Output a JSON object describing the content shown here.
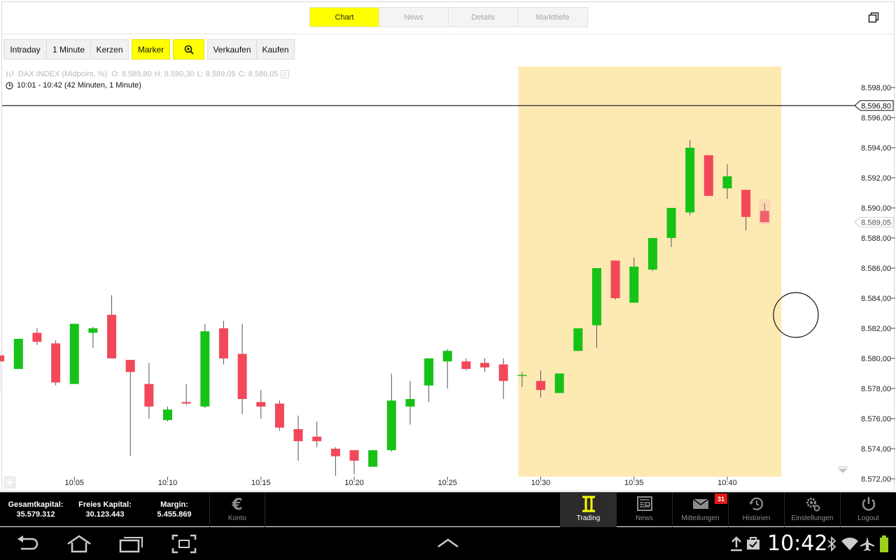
{
  "tabs": [
    {
      "label": "Chart",
      "active": true
    },
    {
      "label": "News",
      "active": false
    },
    {
      "label": "Details",
      "active": false
    },
    {
      "label": "Markttiefe",
      "active": false
    }
  ],
  "toolbar": {
    "intraday": "Intraday",
    "interval": "1 Minute",
    "kerzen": "Kerzen",
    "marker": "Marker",
    "zoom_icon": "zoom-in-icon",
    "verkaufen": "Verkaufen",
    "kaufen": "Kaufen"
  },
  "chart_info": {
    "instrument": "DAX INDEX (Midpoint, %)",
    "open": "O: 8.589,80",
    "high": "H: 8.590,30",
    "low": "L: 8.589,05",
    "close": "C: 8.589,05",
    "range": "10:01 - 10:42 (42 Minuten, 1 Minute)"
  },
  "chart_data": {
    "type": "candlestick",
    "y_ticks": [
      "8.572,00",
      "8.574,00",
      "8.576,00",
      "8.578,00",
      "8.580,00",
      "8.582,00",
      "8.584,00",
      "8.586,00",
      "8.588,00",
      "8.590,00",
      "8.592,00",
      "8.594,00",
      "8.596,00",
      "8.598,00"
    ],
    "ylim": [
      8571.9,
      8599.2
    ],
    "x_ticks": [
      "10:05",
      "10:10",
      "10:15",
      "10:20",
      "10:25",
      "10:30",
      "10:35",
      "10:40"
    ],
    "x_tick_minutes": [
      5,
      10,
      15,
      20,
      25,
      30,
      35,
      40
    ],
    "marker_line": {
      "value": 8596.8,
      "label": "8.596,80"
    },
    "last_price": {
      "value": 8589.05,
      "label": "8.589,05"
    },
    "highlight_minutes": [
      28.8,
      42.9
    ],
    "colors": {
      "up": "#16c216",
      "down": "#f2485a",
      "highlight": "#fde9b2"
    },
    "candles": [
      {
        "t": 1,
        "o": 8580.2,
        "h": 8580.6,
        "l": 8577.8,
        "c": 8579.8
      },
      {
        "t": 2,
        "o": 8579.3,
        "h": 8581.3,
        "l": 8579.3,
        "c": 8581.3
      },
      {
        "t": 3,
        "o": 8581.7,
        "h": 8582.0,
        "l": 8580.9,
        "c": 8581.1
      },
      {
        "t": 4,
        "o": 8581.0,
        "h": 8581.2,
        "l": 8578.2,
        "c": 8578.4
      },
      {
        "t": 5,
        "o": 8578.3,
        "h": 8582.3,
        "l": 8578.3,
        "c": 8582.3
      },
      {
        "t": 6,
        "o": 8581.7,
        "h": 8582.1,
        "l": 8580.7,
        "c": 8582.0
      },
      {
        "t": 7,
        "o": 8582.9,
        "h": 8584.2,
        "l": 8580.0,
        "c": 8580.0
      },
      {
        "t": 8,
        "o": 8579.9,
        "h": 8579.9,
        "l": 8573.5,
        "c": 8579.1
      },
      {
        "t": 9,
        "o": 8578.3,
        "h": 8579.7,
        "l": 8576.0,
        "c": 8576.8
      },
      {
        "t": 10,
        "o": 8575.9,
        "h": 8576.8,
        "l": 8575.8,
        "c": 8576.6
      },
      {
        "t": 11,
        "o": 8577.1,
        "h": 8578.3,
        "l": 8576.9,
        "c": 8577.0
      },
      {
        "t": 12,
        "o": 8576.8,
        "h": 8582.3,
        "l": 8576.7,
        "c": 8581.8
      },
      {
        "t": 13,
        "o": 8582.0,
        "h": 8582.5,
        "l": 8579.6,
        "c": 8580.0
      },
      {
        "t": 14,
        "o": 8580.3,
        "h": 8582.3,
        "l": 8576.3,
        "c": 8577.3
      },
      {
        "t": 15,
        "o": 8577.1,
        "h": 8577.9,
        "l": 8576.0,
        "c": 8576.8
      },
      {
        "t": 16,
        "o": 8577.0,
        "h": 8577.2,
        "l": 8575.2,
        "c": 8575.4
      },
      {
        "t": 17,
        "o": 8575.3,
        "h": 8576.2,
        "l": 8573.2,
        "c": 8574.5
      },
      {
        "t": 18,
        "o": 8574.8,
        "h": 8575.8,
        "l": 8574.1,
        "c": 8574.5
      },
      {
        "t": 19,
        "o": 8574.0,
        "h": 8574.1,
        "l": 8572.2,
        "c": 8573.5
      },
      {
        "t": 20,
        "o": 8573.9,
        "h": 8573.9,
        "l": 8572.3,
        "c": 8573.2
      },
      {
        "t": 21,
        "o": 8572.8,
        "h": 8573.9,
        "l": 8572.8,
        "c": 8573.9
      },
      {
        "t": 22,
        "o": 8573.9,
        "h": 8579.0,
        "l": 8573.8,
        "c": 8577.2
      },
      {
        "t": 23,
        "o": 8576.8,
        "h": 8578.5,
        "l": 8575.6,
        "c": 8577.3
      },
      {
        "t": 24,
        "o": 8578.2,
        "h": 8580.0,
        "l": 8577.1,
        "c": 8580.0
      },
      {
        "t": 25,
        "o": 8579.8,
        "h": 8580.6,
        "l": 8578.0,
        "c": 8580.5
      },
      {
        "t": 26,
        "o": 8579.8,
        "h": 8580.0,
        "l": 8579.2,
        "c": 8579.3
      },
      {
        "t": 27,
        "o": 8579.7,
        "h": 8580.0,
        "l": 8579.1,
        "c": 8579.4
      },
      {
        "t": 28,
        "o": 8579.6,
        "h": 8580.0,
        "l": 8577.3,
        "c": 8578.5
      },
      {
        "t": 29,
        "o": 8578.9,
        "h": 8579.1,
        "l": 8578.1,
        "c": 8578.9
      },
      {
        "t": 30,
        "o": 8578.5,
        "h": 8579.2,
        "l": 8577.4,
        "c": 8577.9
      },
      {
        "t": 31,
        "o": 8577.7,
        "h": 8579.0,
        "l": 8577.7,
        "c": 8579.0
      },
      {
        "t": 32,
        "o": 8580.5,
        "h": 8582.0,
        "l": 8580.5,
        "c": 8582.0
      },
      {
        "t": 33,
        "o": 8582.2,
        "h": 8583.3,
        "l": 8580.7,
        "c": 8586.0
      },
      {
        "t": 34,
        "o": 8586.5,
        "h": 8586.5,
        "l": 8583.9,
        "c": 8584.0
      },
      {
        "t": 35,
        "o": 8583.7,
        "h": 8586.7,
        "l": 8583.7,
        "c": 8586.1
      },
      {
        "t": 36,
        "o": 8585.9,
        "h": 8588.0,
        "l": 8585.8,
        "c": 8588.0
      },
      {
        "t": 37,
        "o": 8588.0,
        "h": 8590.0,
        "l": 8587.4,
        "c": 8590.0
      },
      {
        "t": 38,
        "o": 8589.7,
        "h": 8594.5,
        "l": 8589.5,
        "c": 8594.0
      },
      {
        "t": 39,
        "o": 8593.5,
        "h": 8593.5,
        "l": 8590.8,
        "c": 8590.8
      },
      {
        "t": 40,
        "o": 8591.3,
        "h": 8592.9,
        "l": 8590.6,
        "c": 8592.1
      },
      {
        "t": 41,
        "o": 8591.2,
        "h": 8591.2,
        "l": 8588.5,
        "c": 8589.4
      },
      {
        "t": 42,
        "o": 8589.8,
        "h": 8590.3,
        "l": 8589.05,
        "c": 8589.05
      }
    ]
  },
  "account": {
    "gesamt_label": "Gesamtkapital:",
    "gesamt_value": "35.579.312",
    "frei_label": "Freies Kapital:",
    "frei_value": "30.123.443",
    "margin_label": "Margin:",
    "margin_value": "5.455.869"
  },
  "nav": {
    "konto": "Konto",
    "trading": "Trading",
    "news": "News",
    "mitteilungen": "Mitteilungen",
    "mitteilungen_badge": "31",
    "historien": "Historien",
    "einstellungen": "Einstellungen",
    "logout": "Logout"
  },
  "system": {
    "time": "10:42"
  }
}
